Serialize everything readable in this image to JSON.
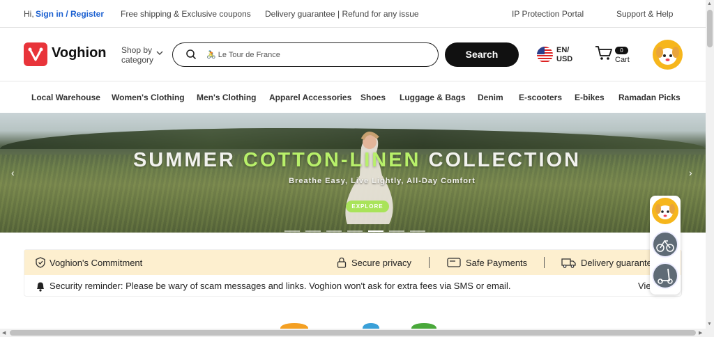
{
  "topbar": {
    "greeting": "Hi,",
    "signin": "Sign in / Register",
    "shipping": "Free shipping & Exclusive coupons",
    "delivery": "Delivery guarantee | Refund for any issue",
    "ip_portal": "IP Protection Portal",
    "support": "Support & Help"
  },
  "header": {
    "logo": "Voghion",
    "shop_by_1": "Shop by",
    "shop_by_2": "category",
    "search_placeholder": "🚴 Le Tour de France",
    "search_button": "Search",
    "lang": "EN/",
    "currency": "USD",
    "cart_count": "0",
    "cart_label": "Cart"
  },
  "categories": [
    "Local Warehouse",
    "Women's Clothing",
    "Men's Clothing",
    "Apparel Accessories",
    "Shoes",
    "Luggage & Bags",
    "Denim",
    "E-scooters",
    "E-bikes",
    "Ramadan Picks"
  ],
  "banner": {
    "title_a": "SUMMER ",
    "title_b": "COTTON-LINEN",
    "title_c": " COLLECTION",
    "subtitle": "Breathe Easy, Live Lightly, All-Day Comfort",
    "button": "EXPLORE",
    "active_slide": 4,
    "slide_count": 7
  },
  "commitment": {
    "title": "Voghion's Commitment",
    "privacy": "Secure privacy",
    "payments": "Safe Payments",
    "delivery": "Delivery guarantee",
    "notice": "Security reminder: Please be wary of scam messages and links. Voghion won't ask for extra fees via SMS or email.",
    "view": "View"
  },
  "colors": {
    "brand": "#e8343a",
    "accent": "#b8f06a",
    "link": "#1a5fd0",
    "commit_bg": "#fdefcf"
  }
}
